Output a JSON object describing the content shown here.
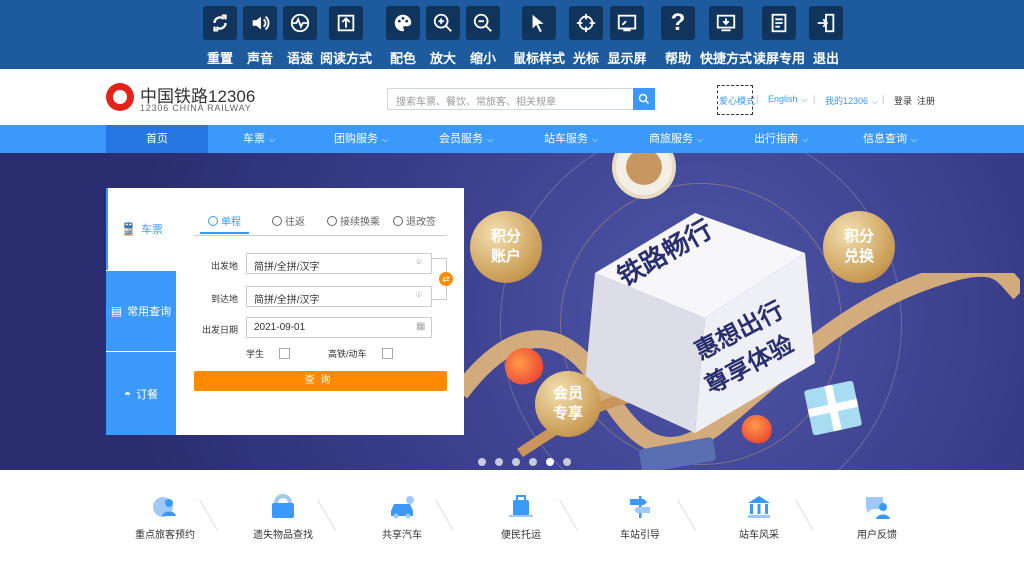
{
  "toolbar": {
    "items": [
      {
        "label": "重置",
        "icon": "refresh-icon"
      },
      {
        "label": "声音",
        "icon": "speaker-icon"
      },
      {
        "label": "语速",
        "icon": "speed-gauge-icon"
      },
      {
        "label": "阅读方式",
        "icon": "read-mode-icon"
      },
      {
        "label": "配色",
        "icon": "palette-icon"
      },
      {
        "label": "放大",
        "icon": "zoom-in-icon"
      },
      {
        "label": "缩小",
        "icon": "zoom-out-icon"
      },
      {
        "label": "鼠标样式",
        "icon": "cursor-icon"
      },
      {
        "label": "光标",
        "icon": "crosshair-icon"
      },
      {
        "label": "显示屏",
        "icon": "display-icon"
      },
      {
        "label": "帮助",
        "icon": "help-icon"
      },
      {
        "label": "快捷方式",
        "icon": "shortcut-icon"
      },
      {
        "label": "读屏专用",
        "icon": "screen-reader-icon"
      },
      {
        "label": "退出",
        "icon": "exit-icon"
      }
    ]
  },
  "header": {
    "logo_cn": "中国铁路12306",
    "logo_en": "12306 CHINA RAILWAY",
    "search_placeholder": "搜索车票、餐饮、常旅客、相关规章",
    "care_mode": "爱心模式",
    "english": "English",
    "my12306": "我的12306",
    "login": "登录",
    "register": "注册"
  },
  "nav": {
    "items": [
      {
        "label": "首页",
        "dropdown": false
      },
      {
        "label": "车票",
        "dropdown": true
      },
      {
        "label": "团购服务",
        "dropdown": true
      },
      {
        "label": "会员服务",
        "dropdown": true
      },
      {
        "label": "站车服务",
        "dropdown": true
      },
      {
        "label": "商旅服务",
        "dropdown": true
      },
      {
        "label": "出行指南",
        "dropdown": true
      },
      {
        "label": "信息查询",
        "dropdown": true
      }
    ]
  },
  "banner": {
    "box_title": "铁路畅行",
    "box_line1": "惠想出行",
    "box_line2": "尊享体验",
    "medal_left": [
      "积分",
      "账户"
    ],
    "medal_right": [
      "积分",
      "兑换"
    ],
    "medal_bottom": [
      "会员",
      "专享"
    ],
    "slides": 6,
    "active_slide": 5
  },
  "ticket": {
    "side_tabs": [
      "车票",
      "常用查询",
      "订餐"
    ],
    "trip_tabs": [
      "单程",
      "往返",
      "接续换乘",
      "退改签"
    ],
    "from_label": "出发地",
    "from_placeholder": "简拼/全拼/汉字",
    "to_label": "到达地",
    "to_placeholder": "简拼/全拼/汉字",
    "date_label": "出发日期",
    "date_value": "2021-09-01",
    "student_label": "学生",
    "highspeed_label": "高铁/动车",
    "query_label": "查询"
  },
  "services": [
    {
      "label": "重点旅客预约",
      "icon": "priority-passenger-icon"
    },
    {
      "label": "遗失物品查找",
      "icon": "lost-items-icon"
    },
    {
      "label": "共享汽车",
      "icon": "shared-car-icon"
    },
    {
      "label": "便民托运",
      "icon": "luggage-icon"
    },
    {
      "label": "车站引导",
      "icon": "signpost-icon"
    },
    {
      "label": "站车风采",
      "icon": "station-icon"
    },
    {
      "label": "用户反馈",
      "icon": "feedback-icon"
    }
  ],
  "colors": {
    "toolbar_bg": "#1d5b9e",
    "brand_blue": "#3b99fc",
    "accent_orange": "#ff8a00",
    "logo_red": "#e2231a"
  }
}
